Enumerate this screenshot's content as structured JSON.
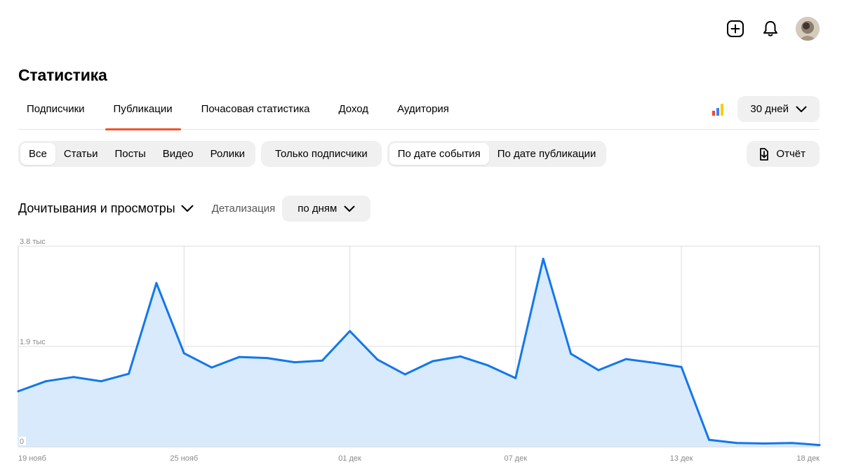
{
  "header": {
    "icons": [
      "add-square-icon",
      "bell-icon",
      "avatar"
    ]
  },
  "page_title": "Статистика",
  "tabs": [
    {
      "label": "Подписчики",
      "active": false
    },
    {
      "label": "Публикации",
      "active": true
    },
    {
      "label": "Почасовая статистика",
      "active": false
    },
    {
      "label": "Доход",
      "active": false
    },
    {
      "label": "Аудитория",
      "active": false
    }
  ],
  "period": {
    "label": "30 дней"
  },
  "content_filter": {
    "items": [
      "Все",
      "Статьи",
      "Посты",
      "Видео",
      "Ролики"
    ],
    "selected": "Все"
  },
  "subscribers_only": {
    "label": "Только подписчики"
  },
  "date_mode": {
    "items": [
      "По дате события",
      "По дате публикации"
    ],
    "selected": "По дате события"
  },
  "report": {
    "label": "Отчёт"
  },
  "metric": {
    "label": "Дочитывания и просмотры"
  },
  "detail": {
    "label": "Детализация",
    "value": "по дням"
  },
  "colors": {
    "accent_tab": "#f0532a",
    "line": "#1277ec",
    "area": "#d9eafc",
    "button_bg": "#f0f0f0",
    "bars_icon": [
      "#f44336",
      "#3d7ff5",
      "#ffcc00"
    ]
  },
  "chart_data": {
    "type": "area",
    "y_tick_labels": [
      "0",
      "1.9 тыс",
      "3.8 тыс"
    ],
    "y_ticks": [
      0,
      1900,
      3800
    ],
    "ylim": [
      0,
      3800
    ],
    "x_tick_labels": [
      "19 нояб",
      "25 нояб",
      "01 дек",
      "07 дек",
      "13 дек",
      "18 дек"
    ],
    "x_tick_index": [
      0,
      6,
      12,
      18,
      24,
      29
    ],
    "values": [
      1050,
      1240,
      1320,
      1240,
      1380,
      3100,
      1770,
      1500,
      1700,
      1680,
      1600,
      1630,
      2190,
      1650,
      1370,
      1620,
      1710,
      1540,
      1300,
      3560,
      1760,
      1450,
      1660,
      1590,
      1510,
      130,
      70,
      60,
      70,
      30
    ],
    "grid": true
  }
}
